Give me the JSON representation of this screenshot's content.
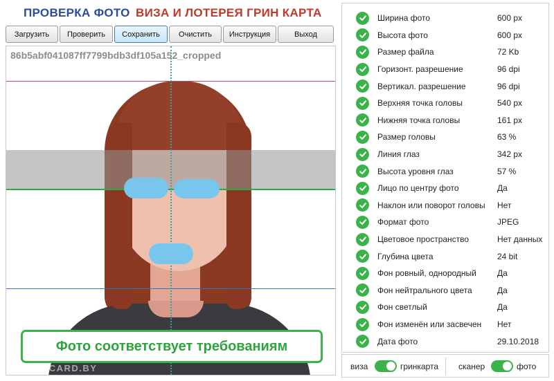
{
  "header": {
    "title_left": "ПРОВЕРКА ФОТО",
    "title_right": "ВИЗА И ЛОТЕРЕЯ ГРИН КАРТА"
  },
  "toolbar": {
    "buttons": [
      "Загрузить",
      "Проверить",
      "Сохранить",
      "Очистить",
      "Инструкция",
      "Выход"
    ],
    "active_index": 2
  },
  "photo": {
    "file_id": "86b5abf041087ff7799bdb3df105a152_cropped",
    "verdict": "Фото соответствует требованиям",
    "watermark": "GREENCARD.BY"
  },
  "checks": [
    {
      "label": "Ширина фото",
      "value": "600 px",
      "status": "ok"
    },
    {
      "label": "Высота фото",
      "value": "600 px",
      "status": "ok"
    },
    {
      "label": "Размер файла",
      "value": "72 Kb",
      "status": "ok"
    },
    {
      "label": "Горизонт. разрешение",
      "value": "96 dpi",
      "status": "ok"
    },
    {
      "label": "Вертикал. разрешение",
      "value": "96 dpi",
      "status": "ok"
    },
    {
      "label": "Верхняя точка головы",
      "value": "540 px",
      "status": "ok"
    },
    {
      "label": "Нижняя точка головы",
      "value": "161 px",
      "status": "ok"
    },
    {
      "label": "Размер головы",
      "value": "63 %",
      "status": "ok"
    },
    {
      "label": "Линия глаз",
      "value": "342 px",
      "status": "ok"
    },
    {
      "label": "Высота уровня глаз",
      "value": "57 %",
      "status": "ok"
    },
    {
      "label": "Лицо по центру фото",
      "value": "Да",
      "status": "ok"
    },
    {
      "label": "Наклон или поворот головы",
      "value": "Нет",
      "status": "ok"
    },
    {
      "label": "Формат фото",
      "value": "JPEG",
      "status": "ok"
    },
    {
      "label": "Цветовое пространство",
      "value": "Нет данных",
      "status": "ok"
    },
    {
      "label": "Глубина цвета",
      "value": "24 bit",
      "status": "ok"
    },
    {
      "label": "Фон ровный, однородный",
      "value": "Да",
      "status": "ok"
    },
    {
      "label": "Фон нейтрального цвета",
      "value": "Да",
      "status": "ok"
    },
    {
      "label": "Фон светлый",
      "value": "Да",
      "status": "ok"
    },
    {
      "label": "Фон изменён или засвечен",
      "value": "Нет",
      "status": "ok"
    },
    {
      "label": "Дата фото",
      "value": "29.10.2018",
      "status": "ok"
    }
  ],
  "toggles": {
    "mode": {
      "left_label": "виза",
      "right_label": "гринкарта",
      "selected": "гринкарта"
    },
    "source": {
      "left_label": "сканер",
      "right_label": "фото",
      "selected": "фото"
    }
  },
  "colors": {
    "accent_green": "#3cb34a",
    "title_blue": "#2a4e9a",
    "title_red": "#c0392b"
  }
}
